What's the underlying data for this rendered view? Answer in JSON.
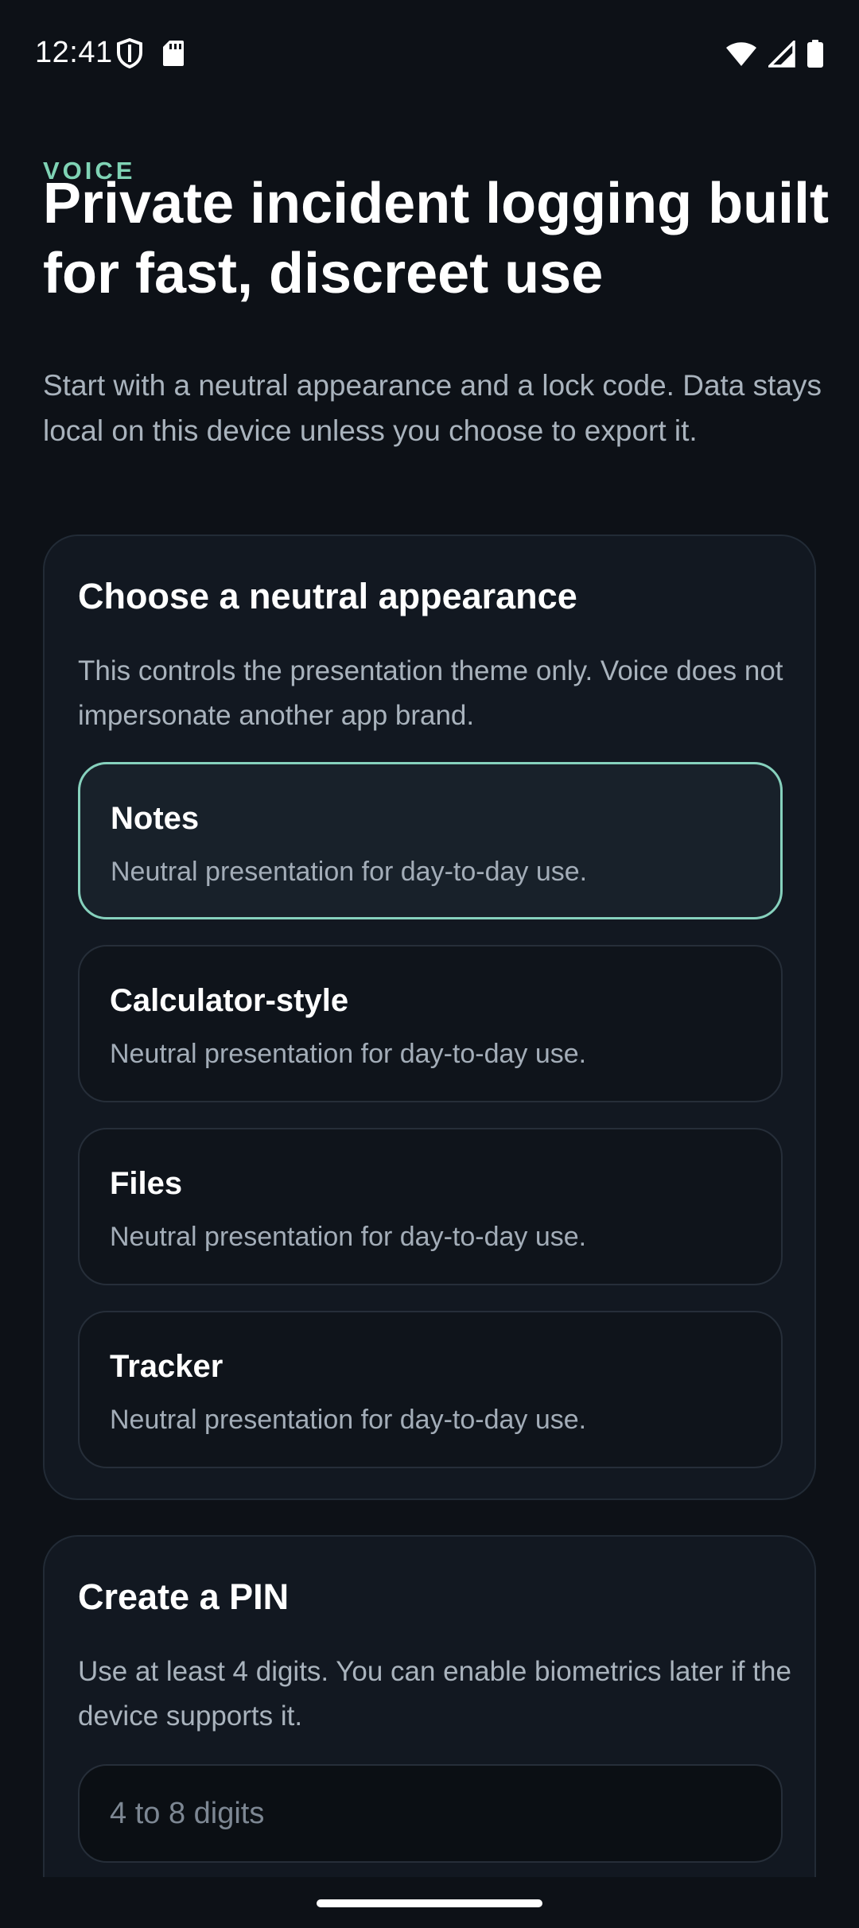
{
  "status_bar": {
    "time": "12:41",
    "left_icons": [
      "shield-icon",
      "sd-card-icon"
    ],
    "right_icons": [
      "wifi-icon",
      "signal-icon",
      "battery-icon"
    ]
  },
  "header": {
    "eyebrow": "VOICE",
    "title": "Private incident logging built for fast, discreet use",
    "subtitle": "Start with a neutral appearance and a lock code. Data stays local on this device unless you choose to export it."
  },
  "appearance": {
    "title": "Choose a neutral appearance",
    "description": "This controls the presentation theme only. Voice does not impersonate another app brand.",
    "selected": "Notes",
    "options": [
      {
        "title": "Notes",
        "description": "Neutral presentation for day-to-day use."
      },
      {
        "title": "Calculator-style",
        "description": "Neutral presentation for day-to-day use."
      },
      {
        "title": "Files",
        "description": "Neutral presentation for day-to-day use."
      },
      {
        "title": "Tracker",
        "description": "Neutral presentation for day-to-day use."
      }
    ]
  },
  "pin": {
    "title": "Create a PIN",
    "description": "Use at least 4 digits. You can enable biometrics later if the device supports it.",
    "placeholder": "4 to 8 digits",
    "value": ""
  },
  "colors": {
    "background": "#0d1117",
    "card": "#121821",
    "accent": "#7fd3b5",
    "selected_border": "#86d1bd"
  }
}
